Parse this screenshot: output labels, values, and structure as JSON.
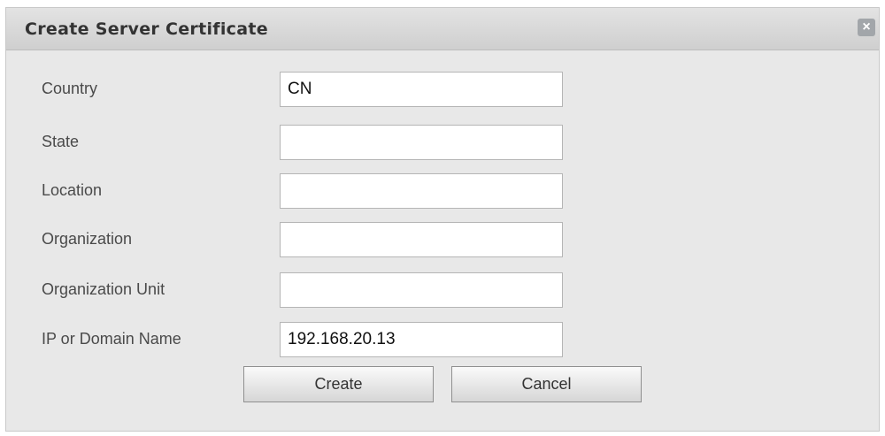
{
  "dialog": {
    "title": "Create Server Certificate",
    "close_glyph": "×",
    "close_icon": "close-icon"
  },
  "fields": [
    {
      "label": "Country",
      "value": "CN"
    },
    {
      "label": "State",
      "value": ""
    },
    {
      "label": "Location",
      "value": ""
    },
    {
      "label": "Organization",
      "value": ""
    },
    {
      "label": "Organization Unit",
      "value": ""
    },
    {
      "label": "IP or Domain Name",
      "value": "192.168.20.13"
    }
  ],
  "buttons": {
    "create_label": "Create",
    "cancel_label": "Cancel"
  }
}
